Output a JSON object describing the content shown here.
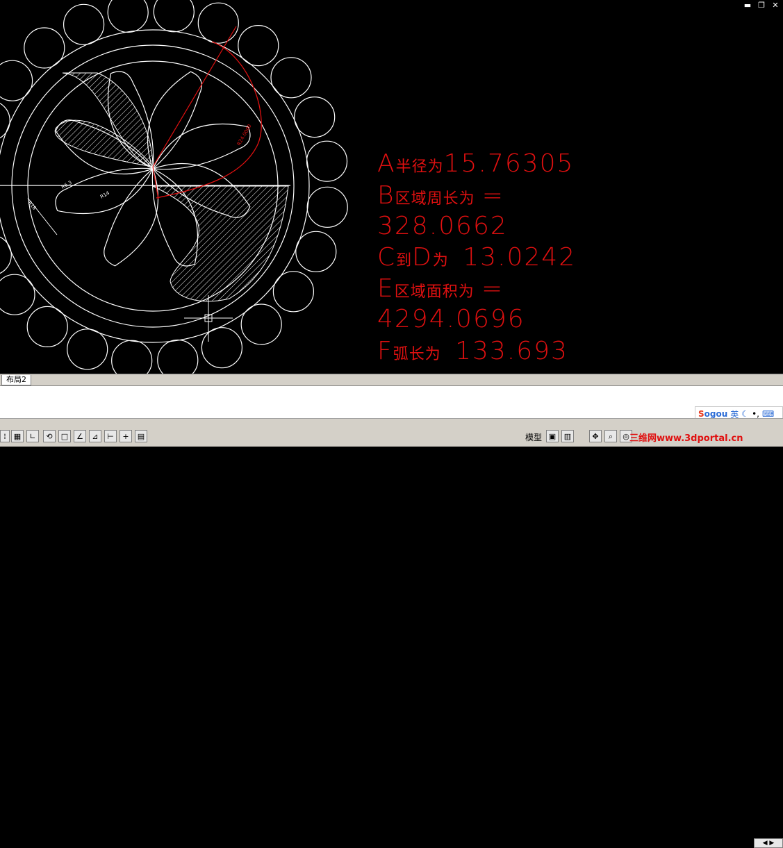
{
  "window": {
    "minimize_glyph": "▬",
    "restore_glyph": "❐",
    "close_glyph": "✕"
  },
  "results": [
    {
      "prefix": "A",
      "label": "半径为",
      "value": "15.76305"
    },
    {
      "prefix": "B",
      "label": "区域周长为",
      "value": "="
    },
    {
      "value_only": "328.0662"
    },
    {
      "prefix": "C",
      "label": "到",
      "mid": "D",
      "label2": "为",
      "value": "13.0242"
    },
    {
      "prefix": "E",
      "label": "区域面积为",
      "value": "="
    },
    {
      "value_only": "4294.0696"
    },
    {
      "prefix": "F",
      "label": "弧长为",
      "value": "133.693"
    }
  ],
  "dims": {
    "d1": "R6.3",
    "d2": "R14",
    "d3": "R18",
    "d4": "R24.0000"
  },
  "tabs": [
    {
      "label": "布局2"
    }
  ],
  "ime": {
    "logo_s": "S",
    "logo_rest": "ogou",
    "mode": "英"
  },
  "status": {
    "model_label": "模型"
  },
  "watermark": "三维网www.3dportal.cn",
  "colors": {
    "accent": "#e01010",
    "drawing": "#ffffff",
    "background": "#000000"
  }
}
